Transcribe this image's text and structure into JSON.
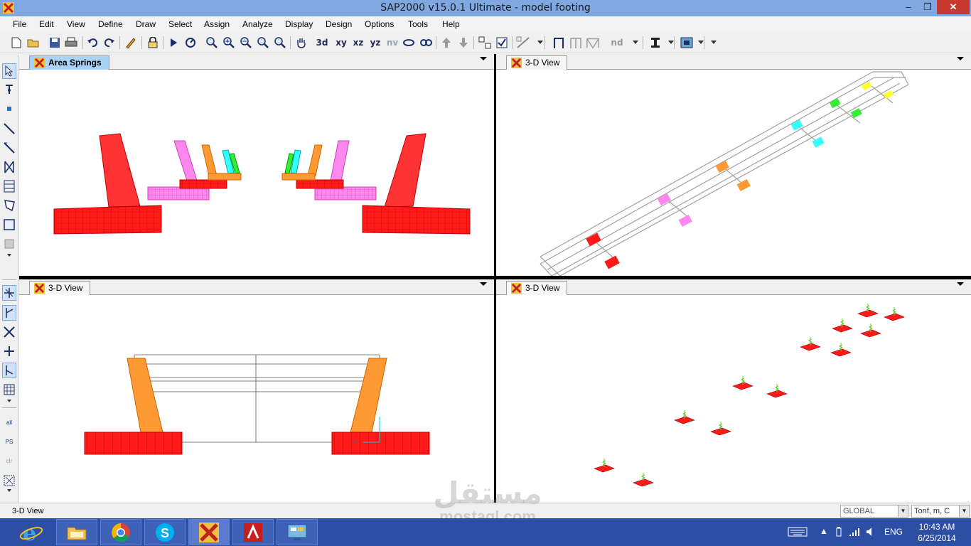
{
  "window": {
    "title": "SAP2000 v15.0.1 Ultimate  - model footing",
    "minimize": "–",
    "maximize": "❐",
    "close": "✕"
  },
  "menu": [
    "File",
    "Edit",
    "View",
    "Define",
    "Draw",
    "Select",
    "Assign",
    "Analyze",
    "Display",
    "Design",
    "Options",
    "Tools",
    "Help"
  ],
  "toolbar": {
    "xy": "xy",
    "xz": "xz",
    "yz": "yz",
    "nv": "nv",
    "nd": "nd",
    "threed": "3d"
  },
  "panes": [
    {
      "tab": "Area Springs",
      "selected": true
    },
    {
      "tab": "3-D View",
      "selected": false
    },
    {
      "tab": "3-D View",
      "selected": false
    },
    {
      "tab": "3-D View",
      "selected": false
    }
  ],
  "pane_axis_label": "Y",
  "left_tools": {
    "all": "all",
    "ps": "PS",
    "clr": "clr"
  },
  "status": {
    "text": "3-D View",
    "coord_system": "GLOBAL",
    "units": "Tonf, m, C"
  },
  "taskbar": {
    "language": "ENG",
    "time": "10:43 AM",
    "date": "6/25/2014"
  },
  "watermark": {
    "arabic": "مستقل",
    "latin": "mostaql.com"
  },
  "colors": {
    "titlebar": "#7fa7e0",
    "selected_tab": "#aad2f4",
    "footing_red": "#ff1a1a",
    "column_orange": "#ff9933",
    "column_pink": "#ff88ee",
    "column_cyan": "#33ffff",
    "column_green": "#33ee33",
    "column_yellow": "#ffff33",
    "frame_gray": "#a0a0a0",
    "taskbar": "#2c4fa4"
  }
}
